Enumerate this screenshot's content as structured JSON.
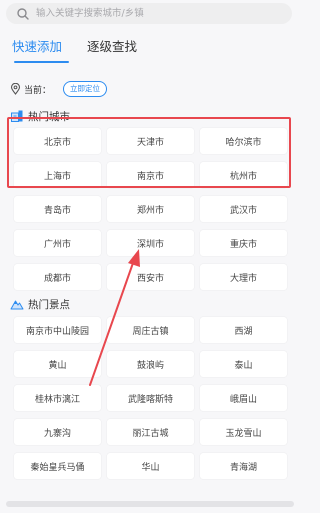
{
  "search": {
    "placeholder": "输入关键字搜索城市/乡镇"
  },
  "tabs": [
    {
      "label": "快速添加",
      "active": true
    },
    {
      "label": "逐级查找",
      "active": false
    }
  ],
  "current": {
    "label": "当前：",
    "locate_button": "立即定位"
  },
  "hot_cities": {
    "title": "热门城市",
    "items": [
      "北京市",
      "天津市",
      "哈尔滨市",
      "上海市",
      "南京市",
      "杭州市",
      "青岛市",
      "郑州市",
      "武汉市",
      "广州市",
      "深圳市",
      "重庆市",
      "成都市",
      "西安市",
      "大理市"
    ]
  },
  "hot_spots": {
    "title": "热门景点",
    "items": [
      "南京市中山陵园",
      "周庄古镇",
      "西湖",
      "黄山",
      "鼓浪屿",
      "泰山",
      "桂林市漓江",
      "武隆喀斯特",
      "峨眉山",
      "九寨沟",
      "丽江古城",
      "玉龙雪山",
      "秦始皇兵马俑",
      "华山",
      "青海湖"
    ]
  },
  "colors": {
    "accent": "#2d8cf0",
    "annotation": "#e8474e"
  },
  "icons": {
    "search": "search-icon",
    "location": "location-pin-icon",
    "city": "building-icon",
    "spot": "mountain-icon"
  }
}
